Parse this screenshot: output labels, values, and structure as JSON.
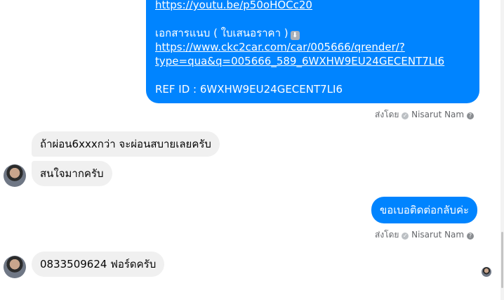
{
  "messages": {
    "quotation": {
      "youtube_link": "https://youtu.be/p50oHOCc20",
      "attachment_label": "เอกสารแนบ ( ใบเสนอราคา )",
      "attachment_icon": "down-arrow-emoji",
      "doc_link_line1": "https://www.ckc2car.com/car/005666/qrender/?",
      "doc_link_line2": "type=qua&q=005666_589_6WXHW9EU24GECENT7LI6",
      "ref_id": "REF ID : 6WXHW9EU24GECENT7LI6",
      "sent_by_prefix": "ส่งโดย",
      "sent_by_name": "Nisarut Nam"
    },
    "incoming_1": "ถ้าผ่อน6xxxกว่า จะผ่อนสบายเลยครับ",
    "incoming_2": "สนใจมากครับ",
    "outgoing_2": {
      "text": "ขอเบอติดต่อกลับค่ะ",
      "sent_by_prefix": "ส่งโดย",
      "sent_by_name": "Nisarut Nam"
    },
    "incoming_3": "0833509624 ฟอร์ดครับ"
  },
  "colors": {
    "outgoing_bubble": "#0084ff",
    "incoming_bubble": "#f0f0f0",
    "meta_text": "#65676b"
  }
}
